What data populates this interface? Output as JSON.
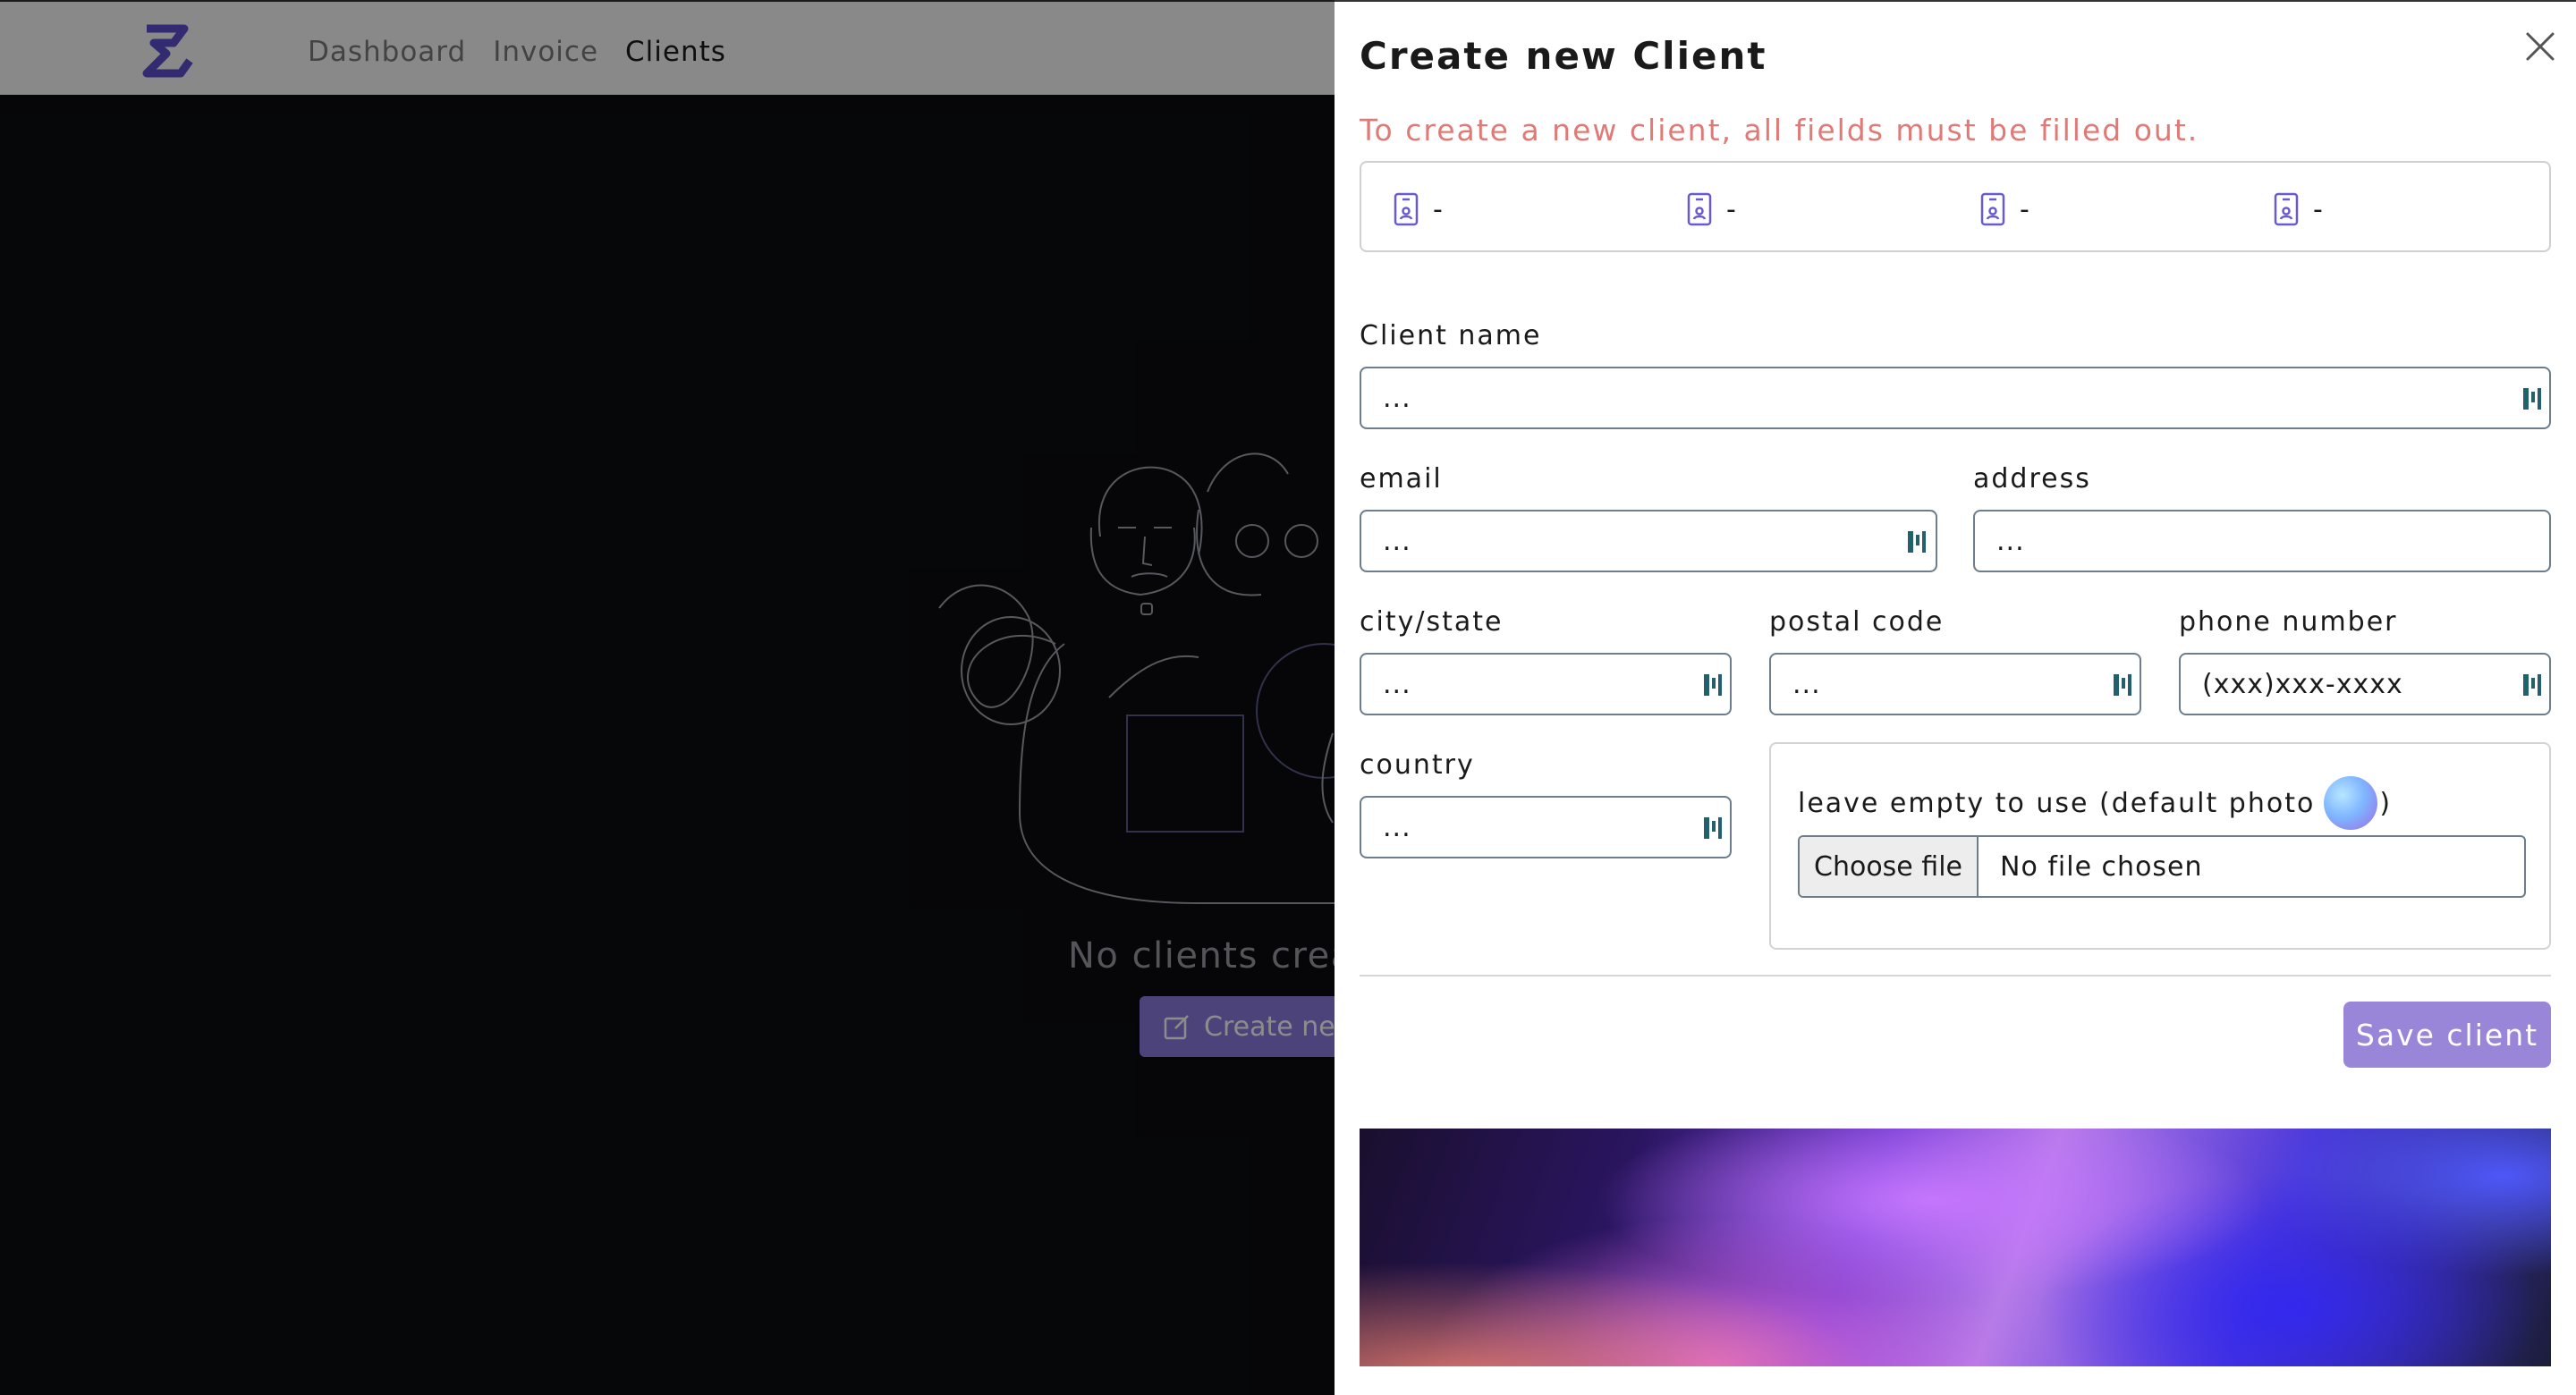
{
  "nav": {
    "items": [
      "Dashboard",
      "Invoice",
      "Clients"
    ],
    "active": "Clients"
  },
  "empty_state": {
    "message": "No clients crea",
    "create_button": "Create new"
  },
  "drawer": {
    "title": "Create new Client",
    "warning": "To create a new client, all fields must be filled out.",
    "preview": [
      "-",
      "-",
      "-",
      "-"
    ],
    "fields": {
      "client_name": {
        "label": "Client name",
        "placeholder": "..."
      },
      "email": {
        "label": "email",
        "placeholder": "..."
      },
      "address": {
        "label": "address",
        "placeholder": "..."
      },
      "city_state": {
        "label": "city/state",
        "placeholder": "..."
      },
      "postal_code": {
        "label": "postal code",
        "placeholder": "..."
      },
      "phone_number": {
        "label": "phone number",
        "placeholder": "(xxx)xxx-xxxx"
      },
      "country": {
        "label": "country",
        "placeholder": "..."
      }
    },
    "photo": {
      "label_before": "leave empty to use (default photo",
      "label_after": ")",
      "choose_button": "Choose file",
      "file_status": "No file chosen"
    },
    "save_button": "Save client"
  },
  "colors": {
    "accent": "#9a86d9",
    "warning": "#e07a76",
    "field_border": "#6d7d8b",
    "backdrop": "#0b0c11"
  },
  "icons": {
    "logo": "s-logo-icon",
    "close": "close-icon",
    "preview": "id-badge-icon",
    "password_manager": "password-manager-icon",
    "create": "edit-icon"
  }
}
